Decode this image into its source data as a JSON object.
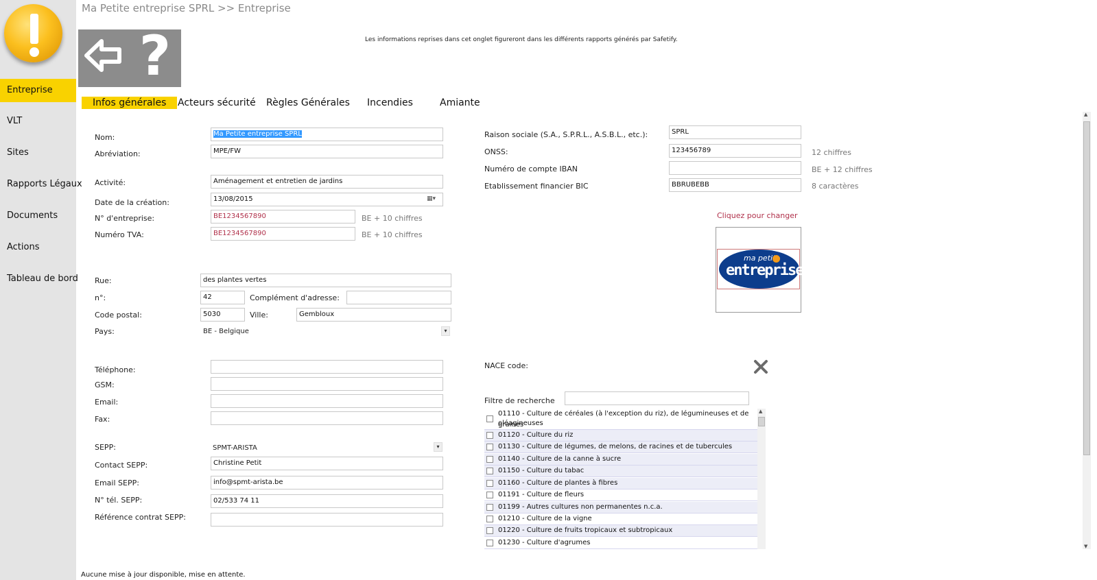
{
  "app": {
    "breadcrumb": "Ma Petite entreprise SPRL >> Entreprise",
    "info_text": "Les informations reprises dans cet onglet figureront dans les différents rapports générés par Safetify."
  },
  "sidebar": {
    "items": [
      {
        "label": "Entreprise"
      },
      {
        "label": "VLT"
      },
      {
        "label": "Sites"
      },
      {
        "label": "Rapports Légaux"
      },
      {
        "label": "Documents"
      },
      {
        "label": "Actions"
      },
      {
        "label": "Tableau de bord"
      }
    ]
  },
  "tabs": [
    {
      "label": "Infos générales"
    },
    {
      "label": "Acteurs sécurité"
    },
    {
      "label": "Règles Générales"
    },
    {
      "label": "Incendies"
    },
    {
      "label": "Amiante"
    }
  ],
  "form": {
    "nom": {
      "label": "Nom:",
      "value": "Ma Petite entreprise SPRL"
    },
    "abreviation": {
      "label": "Abréviation:",
      "value": "MPE/FW"
    },
    "activite": {
      "label": "Activité:",
      "value": "Aménagement et entretien de jardins"
    },
    "date_creation": {
      "label": "Date de la création:",
      "value": "13/08/2015"
    },
    "n_entreprise": {
      "label": "N° d'entreprise:",
      "value": "BE1234567890",
      "hint": "BE + 10 chiffres"
    },
    "numero_tva": {
      "label": "Numéro TVA:",
      "value": "BE1234567890",
      "hint": "BE + 10 chiffres"
    },
    "rue": {
      "label": "Rue:",
      "value": "des plantes vertes"
    },
    "numero": {
      "label": "n°:",
      "value": "42"
    },
    "complement": {
      "label": "Complément d'adresse:",
      "value": ""
    },
    "code_postal": {
      "label": "Code postal:",
      "value": "5030"
    },
    "ville": {
      "label": "Ville:",
      "value": "Gembloux"
    },
    "pays": {
      "label": "Pays:",
      "value": "BE - Belgique"
    },
    "telephone": {
      "label": "Téléphone:",
      "value": ""
    },
    "gsm": {
      "label": "GSM:",
      "value": ""
    },
    "email": {
      "label": "Email:",
      "value": ""
    },
    "fax": {
      "label": "Fax:",
      "value": ""
    },
    "sepp": {
      "label": "SEPP:",
      "value": "SPMT-ARISTA"
    },
    "contact_sepp": {
      "label": "Contact SEPP:",
      "value": "Christine Petit"
    },
    "email_sepp": {
      "label": "Email SEPP:",
      "value": "info@spmt-arista.be"
    },
    "tel_sepp": {
      "label": "N° tél. SEPP:",
      "value": "02/533 74 11"
    },
    "ref_contrat": {
      "label": "Référence contrat SEPP:",
      "value": ""
    },
    "raison_sociale": {
      "label": "Raison sociale (S.A., S.P.R.L., A.S.B.L., etc.):",
      "value": "SPRL"
    },
    "onss": {
      "label": "ONSS:",
      "value": "123456789",
      "hint": "12 chiffres"
    },
    "iban": {
      "label": "Numéro de compte IBAN",
      "value": "",
      "hint": "BE + 12 chiffres"
    },
    "bic": {
      "label": "Etablissement financier BIC",
      "value": "BBRUBEBB",
      "hint": "8 caractères"
    }
  },
  "logo": {
    "change_label": "Cliquez pour changer",
    "line1": "ma petite",
    "line2": "entreprise"
  },
  "nace": {
    "label": "NACE code:",
    "filter_label": "Filtre de recherche",
    "filter_value": "",
    "items": [
      {
        "line1": "01110 - Culture de céréales (à l'exception du riz), de légumineuses et de graines",
        "line2": "oléagineuses"
      },
      {
        "line1": "01120 - Culture du riz"
      },
      {
        "line1": "01130 - Culture de légumes, de melons, de racines et de tubercules"
      },
      {
        "line1": "01140 - Culture de la canne à sucre"
      },
      {
        "line1": "01150 - Culture du tabac"
      },
      {
        "line1": "01160 - Culture de plantes à fibres"
      },
      {
        "line1": "01191 - Culture de fleurs"
      },
      {
        "line1": "01199 - Autres cultures non permanentes n.c.a."
      },
      {
        "line1": "01210 - Culture de la vigne"
      },
      {
        "line1": "01220 - Culture de fruits tropicaux et subtropicaux"
      },
      {
        "line1": "01230 - Culture d'agrumes"
      }
    ]
  },
  "status": "Aucune mise à jour disponible, mise en attente.",
  "colors": {
    "accent": "#f9d200",
    "sidebar": "#e4e4e4",
    "error_text": "#b0304a",
    "logo_blue": "#0d3d8c",
    "logo_orange": "#f29a1a"
  }
}
